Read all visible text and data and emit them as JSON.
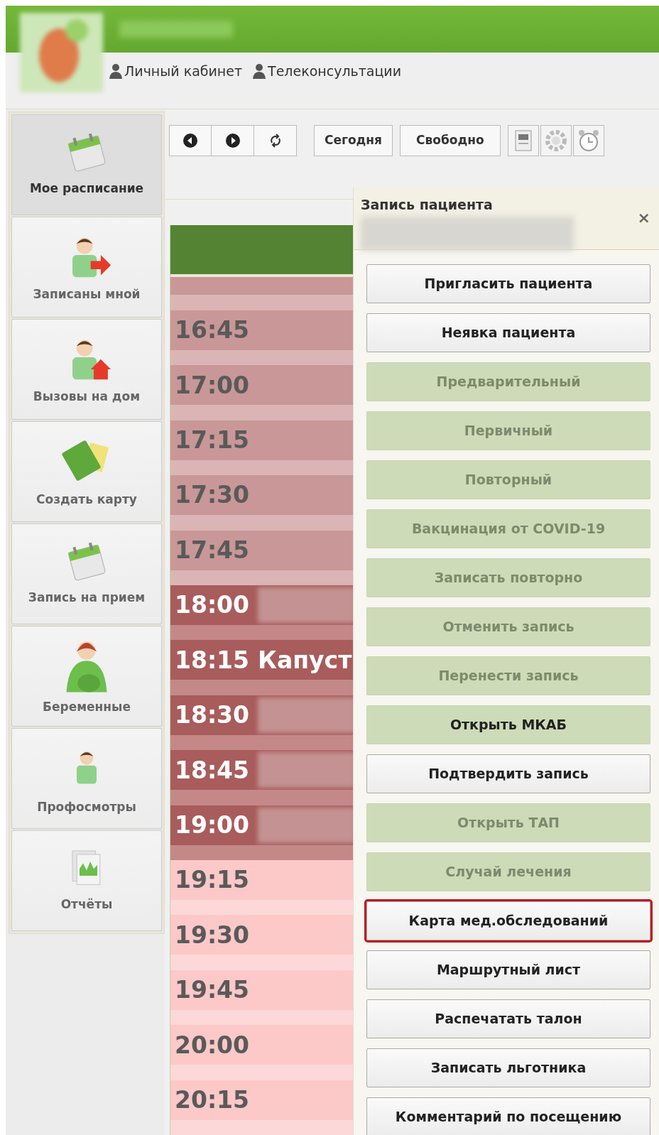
{
  "header": {
    "nav_links": [
      "Личный кабинет",
      "Телеконсультации"
    ]
  },
  "sidebar": {
    "items": [
      {
        "label": "Мое расписание",
        "selected": true
      },
      {
        "label": "Записаны мной",
        "selected": false
      },
      {
        "label": "Вызовы на дом",
        "selected": false
      },
      {
        "label": "Создать карту",
        "selected": false
      },
      {
        "label": "Запись на прием",
        "selected": false
      },
      {
        "label": "Беременные",
        "selected": false
      },
      {
        "label": "Профосмотры",
        "selected": false
      },
      {
        "label": "Отчёты",
        "selected": false
      }
    ]
  },
  "toolbar": {
    "today_button": "Сегодня",
    "free_button": "Свободно"
  },
  "schedule": {
    "slots": [
      {
        "time": "16:45",
        "kind": "past"
      },
      {
        "time": "17:00",
        "kind": "past"
      },
      {
        "time": "17:15",
        "kind": "past"
      },
      {
        "time": "17:30",
        "kind": "past"
      },
      {
        "time": "17:45",
        "kind": "past"
      },
      {
        "time": "18:00",
        "kind": "booked"
      },
      {
        "time": "18:15",
        "kind": "booked",
        "name": "Капуст"
      },
      {
        "time": "18:30",
        "kind": "booked"
      },
      {
        "time": "18:45",
        "kind": "booked"
      },
      {
        "time": "19:00",
        "kind": "booked"
      },
      {
        "time": "19:15",
        "kind": "free"
      },
      {
        "time": "19:30",
        "kind": "free"
      },
      {
        "time": "19:45",
        "kind": "free"
      },
      {
        "time": "20:00",
        "kind": "free"
      },
      {
        "time": "20:15",
        "kind": "free"
      }
    ]
  },
  "popup": {
    "title": "Запись пациента",
    "close": "×",
    "buttons": [
      {
        "label": "Пригласить пациента",
        "kind": "normal",
        "disabled": false,
        "highlighted": false
      },
      {
        "label": "Неявка пациента",
        "kind": "normal",
        "disabled": false,
        "highlighted": false
      },
      {
        "label": "Предварительный",
        "kind": "green",
        "disabled": true,
        "highlighted": false
      },
      {
        "label": "Первичный",
        "kind": "green",
        "disabled": true,
        "highlighted": false
      },
      {
        "label": "Повторный",
        "kind": "green",
        "disabled": true,
        "highlighted": false
      },
      {
        "label": "Вакцинация от COVID-19",
        "kind": "green",
        "disabled": true,
        "highlighted": false
      },
      {
        "label": "Записать повторно",
        "kind": "green",
        "disabled": true,
        "highlighted": false
      },
      {
        "label": "Отменить запись",
        "kind": "green",
        "disabled": true,
        "highlighted": false
      },
      {
        "label": "Перенести запись",
        "kind": "green",
        "disabled": true,
        "highlighted": false
      },
      {
        "label": "Открыть МКАБ",
        "kind": "green",
        "disabled": false,
        "highlighted": false
      },
      {
        "label": "Подтвердить запись",
        "kind": "normal",
        "disabled": false,
        "highlighted": false
      },
      {
        "label": "Открыть ТАП",
        "kind": "green",
        "disabled": true,
        "highlighted": false
      },
      {
        "label": "Случай лечения",
        "kind": "green",
        "disabled": true,
        "highlighted": false
      },
      {
        "label": "Карта мед.обследований",
        "kind": "normal",
        "disabled": false,
        "highlighted": true
      },
      {
        "label": "Маршрутный лист",
        "kind": "normal",
        "disabled": false,
        "highlighted": false
      },
      {
        "label": "Распечатать талон",
        "kind": "normal",
        "disabled": false,
        "highlighted": false
      },
      {
        "label": "Записать льготника",
        "kind": "normal",
        "disabled": false,
        "highlighted": false
      },
      {
        "label": "Комментарий по посещению",
        "kind": "normal",
        "disabled": false,
        "highlighted": false
      }
    ]
  }
}
